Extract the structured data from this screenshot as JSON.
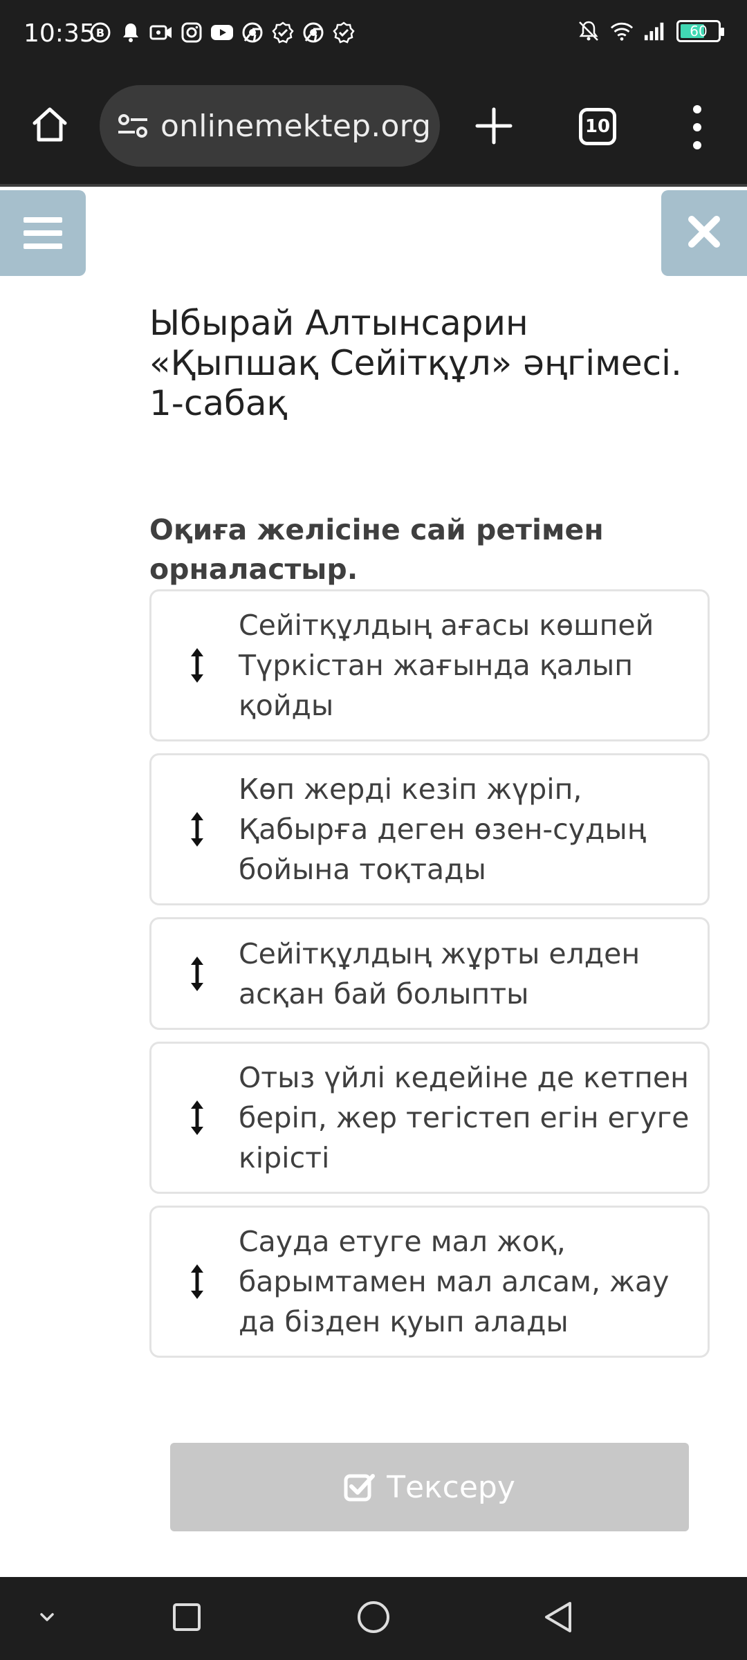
{
  "status_bar": {
    "time": "10:35",
    "battery": "60",
    "left_icons": [
      "b-badge-icon",
      "bell-icon",
      "video-call-icon",
      "instagram-icon",
      "youtube-icon",
      "chrome-icon",
      "verified-icon",
      "chrome-icon",
      "verified-icon"
    ],
    "right_icons": [
      "bell-off-icon",
      "wifi-icon",
      "signal-icon",
      "battery-icon"
    ]
  },
  "browser": {
    "url": "onlinemektep.org",
    "tab_count": "10"
  },
  "page": {
    "title": "Ыбырай Алтынсарин «Қыпшақ Сейітқұл» әңгімесі. 1-сабақ",
    "instruction": "Оқиға желісіне сай ретімен орналастыр.",
    "items": [
      {
        "text": "Сейітқұлдың ағасы көшпей Түркістан жағында қалып қойды"
      },
      {
        "text": "Көп жерді кезіп жүріп, Қабырға деген өзен-судың бойына тоқтады"
      },
      {
        "text": "Сейітқұлдың жұрты елден асқан бай болыпты"
      },
      {
        "text": "Отыз үйлі кедейіне де кетпен беріп, жер тегістеп егін егуге кірісті"
      },
      {
        "text": "Сауда етуге мал жоқ, барымтамен мал алсам, жау да бізден қуып алады"
      }
    ],
    "check_button": "Тексеру"
  },
  "colors": {
    "side_button": "#a6bfcc",
    "disabled_button": "#c8c8c8",
    "system_bar": "#1e1e1e",
    "battery_fill": "#41d8b3"
  }
}
